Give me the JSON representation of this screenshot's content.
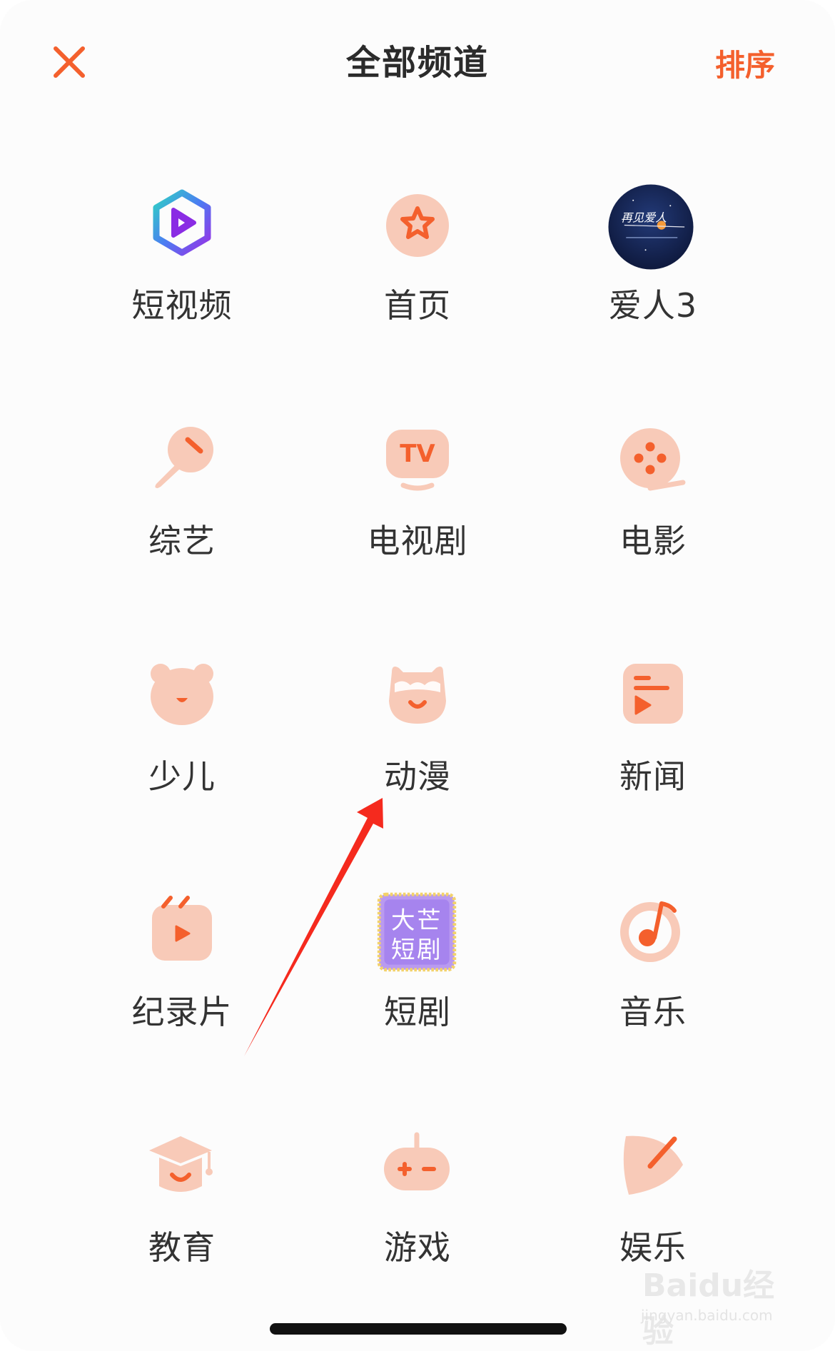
{
  "header": {
    "title": "全部频道",
    "sort_label": "排序"
  },
  "channels": [
    {
      "label": "短视频",
      "icon": "short-video-hexagon-play-icon"
    },
    {
      "label": "首页",
      "icon": "star-circle-icon"
    },
    {
      "label": "爱人3",
      "icon": "drama-poster-avatar"
    },
    {
      "label": "综艺",
      "icon": "microphone-icon"
    },
    {
      "label": "电视剧",
      "icon": "tv-icon"
    },
    {
      "label": "电影",
      "icon": "film-reel-icon"
    },
    {
      "label": "少儿",
      "icon": "bear-face-icon"
    },
    {
      "label": "动漫",
      "icon": "anime-character-icon"
    },
    {
      "label": "新闻",
      "icon": "news-play-icon"
    },
    {
      "label": "纪录片",
      "icon": "clapperboard-play-icon"
    },
    {
      "label": "短剧",
      "icon": "damang-short-drama-stamp-icon"
    },
    {
      "label": "音乐",
      "icon": "music-note-icon"
    },
    {
      "label": "教育",
      "icon": "graduation-cap-icon"
    },
    {
      "label": "游戏",
      "icon": "gamepad-icon"
    },
    {
      "label": "娱乐",
      "icon": "leaf-pen-icon"
    }
  ],
  "stamp_text": "大芒短剧",
  "avatar_text": "再见爱人",
  "watermark": {
    "main": "Baidu经验",
    "sub": "jingyan.baidu.com"
  },
  "colors": {
    "accent": "#f4602d",
    "icon_fill": "#f8cab8",
    "icon_mark": "#f4602d",
    "annotation_arrow": "#f52a1e"
  }
}
